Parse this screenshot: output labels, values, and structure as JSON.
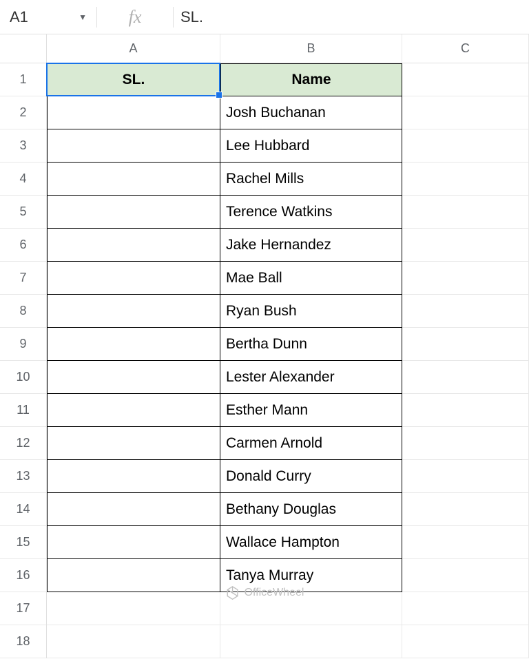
{
  "nameBox": "A1",
  "fxLabel": "fx",
  "formulaValue": "SL.",
  "columns": [
    "A",
    "B",
    "C"
  ],
  "rowNumbers": [
    1,
    2,
    3,
    4,
    5,
    6,
    7,
    8,
    9,
    10,
    11,
    12,
    13,
    14,
    15,
    16,
    17,
    18
  ],
  "headers": {
    "colA": "SL.",
    "colB": "Name"
  },
  "names": [
    "Josh Buchanan",
    "Lee Hubbard",
    "Rachel Mills",
    "Terence Watkins",
    "Jake Hernandez",
    "Mae Ball",
    "Ryan Bush",
    "Bertha Dunn",
    "Lester Alexander",
    "Esther Mann",
    "Carmen Arnold",
    "Donald Curry",
    "Bethany Douglas",
    "Wallace Hampton",
    "Tanya Murray"
  ],
  "watermark": "OfficeWheel"
}
